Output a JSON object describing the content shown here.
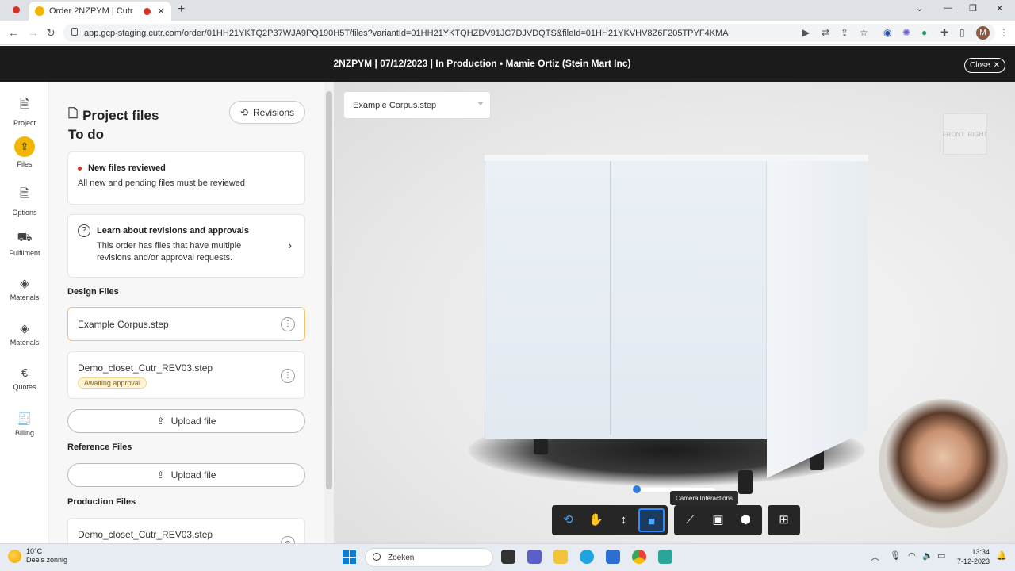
{
  "browser": {
    "tab_title": "Order 2NZPYM | Cutr",
    "url": "app.gcp-staging.cutr.com/order/01HH21YKTQ2P37WJA9PQ190H5T/files?variantId=01HH21YKTQHZDV91JC7DJVDQTS&fileId=01HH21YKVHV8Z6F205TPYF4KMA",
    "profile_initial": "M"
  },
  "header": {
    "title": "2NZPYM | 07/12/2023 | In Production • Mamie Ortiz (Stein Mart Inc)",
    "close_label": "Close"
  },
  "nav": {
    "items": [
      {
        "label": "Project",
        "icon": "document-icon"
      },
      {
        "label": "Files",
        "icon": "file-upload-icon"
      },
      {
        "label": "Options",
        "icon": "document-icon"
      },
      {
        "label": "Fulfilment",
        "icon": "truck-icon"
      },
      {
        "label": "Materials",
        "icon": "layers-icon"
      },
      {
        "label": "Materials",
        "icon": "layers-icon"
      },
      {
        "label": "Quotes",
        "icon": "euro-icon"
      },
      {
        "label": "Billing",
        "icon": "receipt-icon"
      }
    ],
    "active": "Files"
  },
  "files_panel": {
    "title": "Project files",
    "subtitle": "To do",
    "revisions_label": "Revisions",
    "alert": {
      "heading": "New files reviewed",
      "body": "All new and pending files must be reviewed"
    },
    "info": {
      "heading": "Learn about revisions and approvals",
      "body": "This order has files that have multiple revisions and/or approval requests."
    },
    "design_files": {
      "heading": "Design Files",
      "files": [
        {
          "name": "Example Corpus.step"
        },
        {
          "name": "Demo_closet_Cutr_REV03.step",
          "badge": "Awaiting approval"
        }
      ],
      "upload_label": "Upload file"
    },
    "reference_files": {
      "heading": "Reference Files",
      "upload_label": "Upload file"
    },
    "production_files": {
      "heading": "Production Files",
      "files": [
        {
          "name": "Demo_closet_Cutr_REV03.step"
        }
      ]
    }
  },
  "viewer": {
    "selected_file": "Example Corpus.step",
    "viewcube_faces": [
      "FRONT",
      "RIGHT"
    ],
    "tooltip": "Camera Interactions",
    "toolbar": [
      {
        "name": "orbit-icon",
        "glyph": "⟲"
      },
      {
        "name": "pan-hand-icon",
        "glyph": "✋"
      },
      {
        "name": "zoom-vertical-icon",
        "glyph": "↕"
      },
      {
        "name": "camera-icon",
        "glyph": "■"
      },
      {
        "name": "measure-ruler-icon",
        "glyph": "📏"
      },
      {
        "name": "section-box-icon",
        "glyph": "▣"
      },
      {
        "name": "explode-cube-icon",
        "glyph": "⬢"
      },
      {
        "name": "hierarchy-icon",
        "glyph": "⊞"
      }
    ]
  },
  "taskbar": {
    "weather_temp": "10°C",
    "weather_desc": "Deels zonnig",
    "search_placeholder": "Zoeken",
    "time": "13:34",
    "date": "7-12-2023"
  }
}
